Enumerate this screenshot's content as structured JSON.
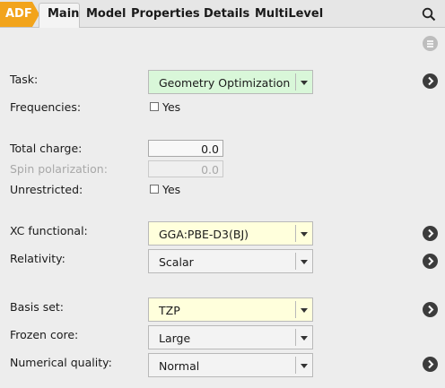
{
  "tabs": {
    "adf": "ADF",
    "main": "Main",
    "model": "Model",
    "properties": "Properties",
    "details": "Details",
    "multilevel": "MultiLevel"
  },
  "form": {
    "task": {
      "label": "Task:",
      "value": "Geometry Optimization"
    },
    "frequencies": {
      "label": "Frequencies:",
      "checkbox_label": "Yes",
      "checked": false
    },
    "total_charge": {
      "label": "Total charge:",
      "value": "0.0"
    },
    "spin_polarization": {
      "label": "Spin polarization:",
      "value": "0.0"
    },
    "unrestricted": {
      "label": "Unrestricted:",
      "checkbox_label": "Yes",
      "checked": false
    },
    "xc_functional": {
      "label": "XC functional:",
      "value": "GGA:PBE-D3(BJ)"
    },
    "relativity": {
      "label": "Relativity:",
      "value": "Scalar"
    },
    "basis_set": {
      "label": "Basis set:",
      "value": "TZP"
    },
    "frozen_core": {
      "label": "Frozen core:",
      "value": "Large"
    },
    "numerical_quality": {
      "label": "Numerical quality:",
      "value": "Normal"
    }
  },
  "colors": {
    "adf_tab": "#f2a41c",
    "task_combo_bg": "#d9f7d9",
    "highlight_combo_bg": "#ffffdc"
  }
}
